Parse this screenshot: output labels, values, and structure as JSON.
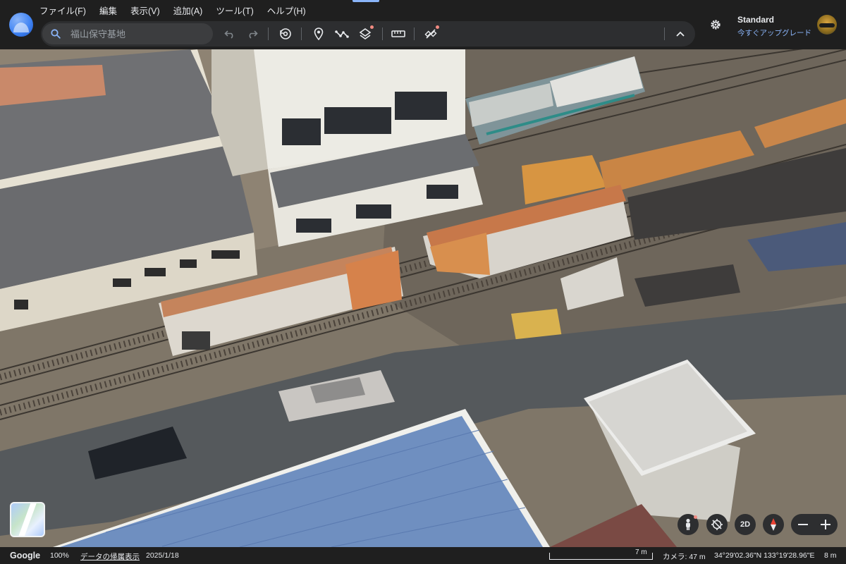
{
  "app": {
    "name": "Google Earth"
  },
  "menu": [
    "ファイル(F)",
    "編集",
    "表示(V)",
    "追加(A)",
    "ツール(T)",
    "ヘルプ(H)"
  ],
  "search": {
    "placeholder": "福山保守基地",
    "value": ""
  },
  "toolbar": {
    "icons": [
      "undo-icon",
      "redo-icon",
      "history-icon",
      "placemark-icon",
      "path-icon",
      "layers-icon",
      "ruler-icon",
      "satellite-icon",
      "collapse-chevron-icon"
    ]
  },
  "account": {
    "plan": "Standard",
    "upgrade": "今すぐアップグレード"
  },
  "controls": {
    "view_mode": "2D"
  },
  "status": {
    "google": "Google",
    "zoom": "100%",
    "attribution": "データの帰属表示",
    "date": "2025/1/18",
    "scale": "7 m",
    "camera": "カメラ: 47 m",
    "coords": "34°29'02.36\"N 133°19'28.96\"E",
    "elevation": "8 m"
  },
  "colors": {
    "accent": "#8ab4f8",
    "bar": "#1f1f1f",
    "pill": "#2d2e30",
    "badge": "#f28b82"
  }
}
